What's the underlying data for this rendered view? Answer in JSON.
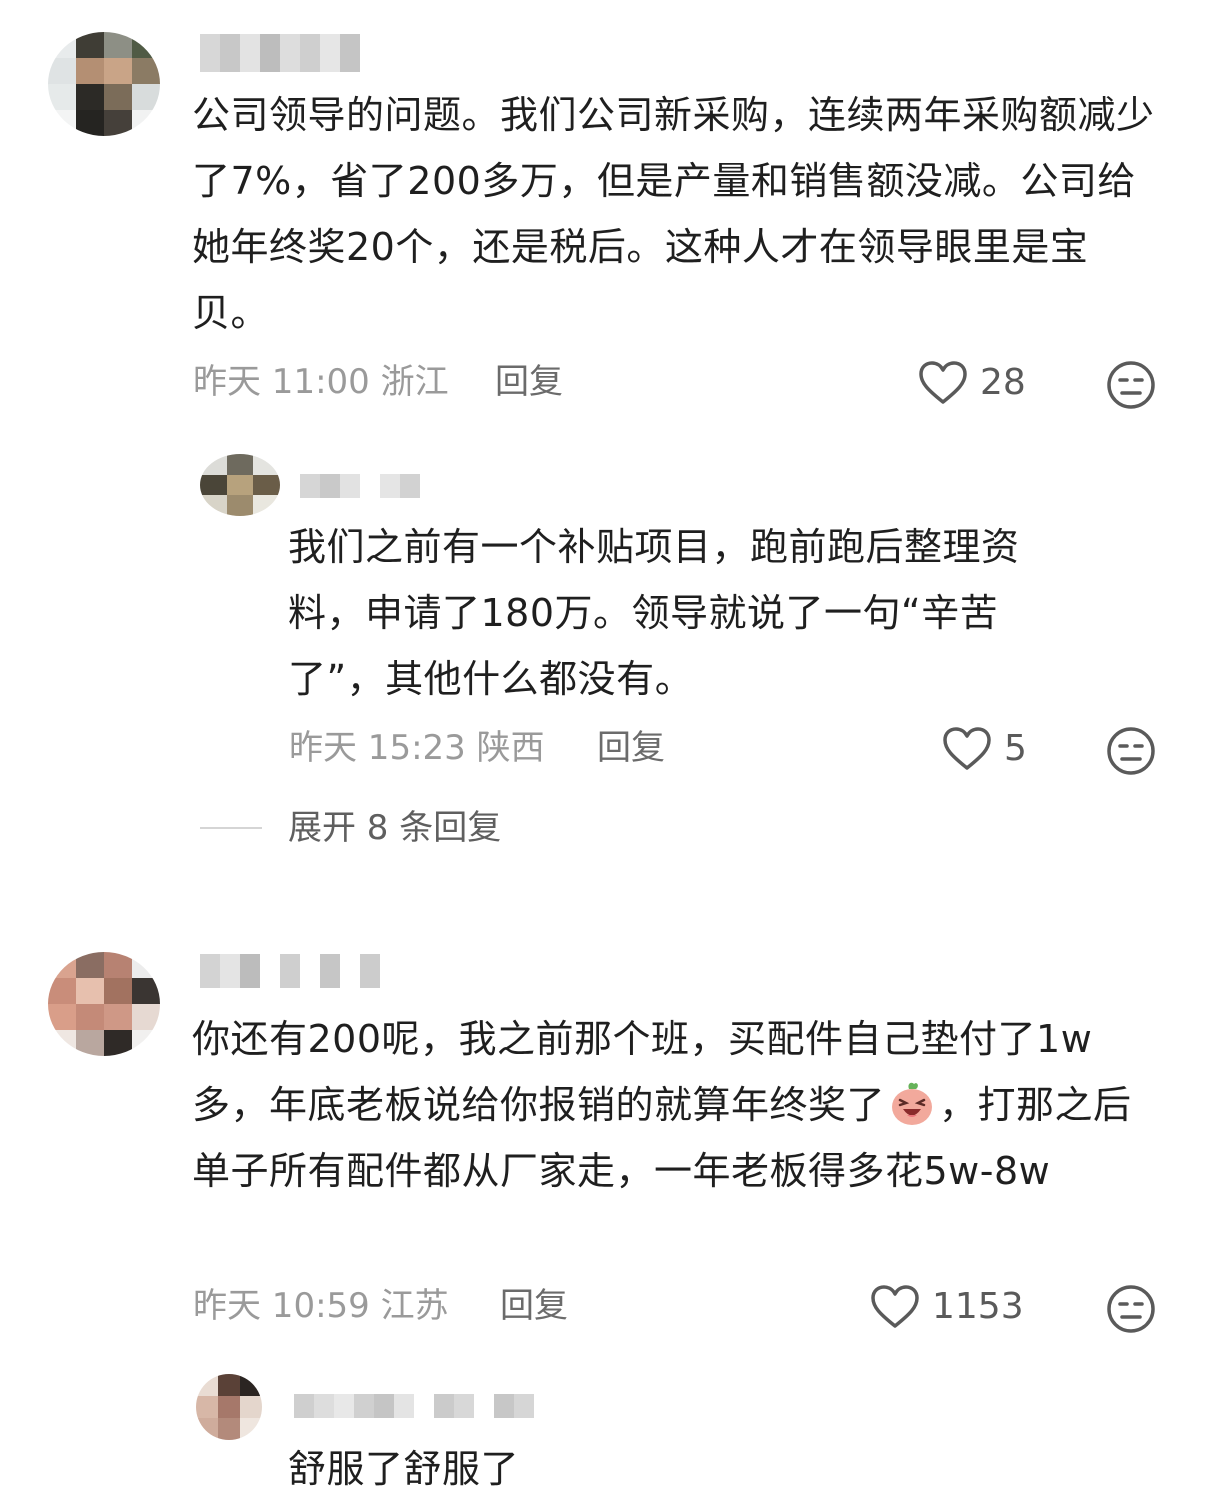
{
  "comments": [
    {
      "text": "公司领导的问题。我们公司新采购，连续两年采购额减少了7%，省了200多万，但是产量和销售额没减。公司给她年终奖20个，还是税后。这种人才在领导眼里是宝贝。",
      "time": "昨天 11:00 浙江",
      "reply_label": "回复",
      "likes": "28",
      "replies": [
        {
          "text": "我们之前有一个补贴项目，跑前跑后整理资料，申请了180万。领导就说了一句“辛苦了”，其他什么都没有。",
          "time": "昨天 15:23 陕西",
          "reply_label": "回复",
          "likes": "5"
        }
      ],
      "expand_label": "展开 8 条回复"
    },
    {
      "text_before_emoji": "你还有200呢，我之前那个班，买配件自己垫付了1w多，年底老板说给你报销的就算年终奖了",
      "text_after_emoji": "，打那之后单子所有配件都从厂家走，一年老板得多花5w-8w",
      "emoji": "laughing-emoji",
      "time": "昨天 10:59 江苏",
      "reply_label": "回复",
      "likes": "1153",
      "replies": [
        {
          "text": "舒服了舒服了"
        }
      ]
    }
  ],
  "icons": {
    "like": "heart-outline-icon",
    "dislike": "meh-face-icon"
  },
  "colors": {
    "text": "#1f1f1f",
    "meta": "#9a9a9a",
    "action": "#6b6b6b"
  }
}
